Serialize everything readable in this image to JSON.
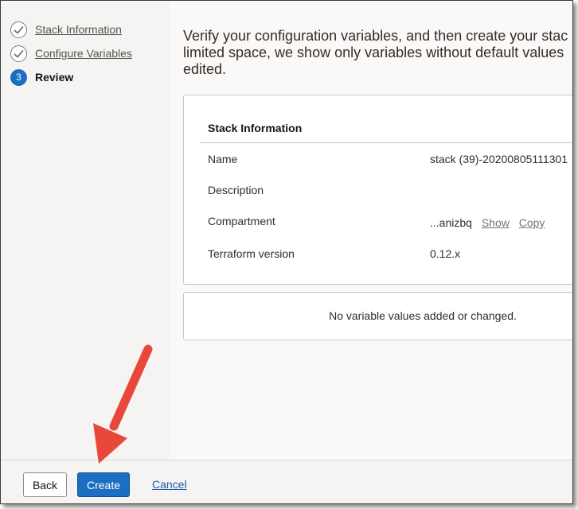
{
  "steps": [
    {
      "label": "Stack Information",
      "state": "done",
      "icon": "check-icon"
    },
    {
      "label": "Configure Variables",
      "state": "done",
      "icon": "check-icon"
    },
    {
      "label": "Review",
      "state": "current",
      "number": "3"
    }
  ],
  "intro": {
    "line1": "Verify your configuration variables, and then create your stac",
    "line2": "limited space, we show only variables without default values",
    "line3": "edited."
  },
  "stack_info": {
    "title": "Stack Information",
    "rows": [
      {
        "key": "Name",
        "value": "stack (39)-20200805111301"
      },
      {
        "key": "Description",
        "value": ""
      },
      {
        "key": "Compartment",
        "value": "...anizbq",
        "show_label": "Show",
        "copy_label": "Copy"
      },
      {
        "key": "Terraform version",
        "value": "0.12.x"
      }
    ]
  },
  "variables_panel": {
    "message": "No variable values added or changed."
  },
  "footer": {
    "back_label": "Back",
    "create_label": "Create",
    "cancel_label": "Cancel"
  },
  "colors": {
    "primary": "#1b6ec2",
    "annotation_arrow": "#e8473a"
  }
}
